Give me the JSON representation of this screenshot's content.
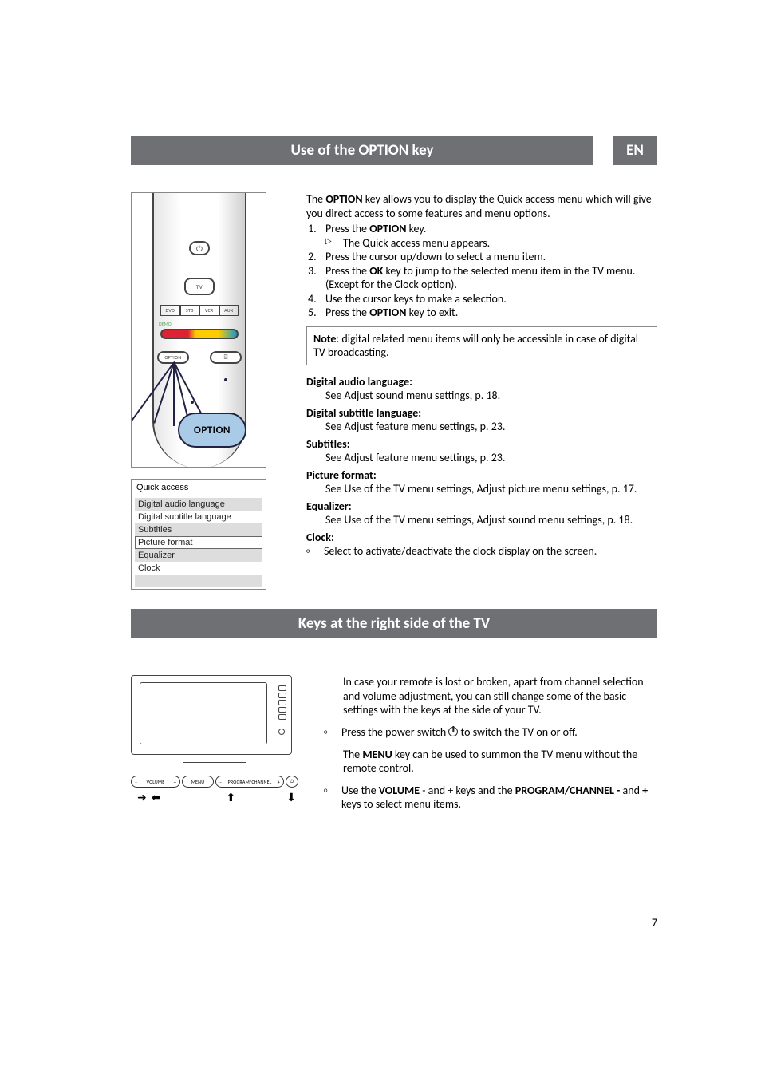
{
  "lang_pill": "EN",
  "section1": {
    "title": "Use of the OPTION key",
    "remote": {
      "power_icon": "⏻",
      "tv_label": "TV",
      "src_buttons": [
        "DVD",
        "STB",
        "VCR",
        "AUX"
      ],
      "demo_label": "DEMO",
      "option_label": "OPTION",
      "guide_icon": "⌼",
      "callout": "OPTION"
    },
    "quick_access": {
      "title": "Quick access",
      "items": [
        "Digital audio language",
        "Digital subtitle language",
        "Subtitles",
        "Picture format",
        "Equalizer",
        "Clock"
      ]
    },
    "intro": {
      "pre": "The ",
      "bold": "OPTION",
      "post": " key allows you to display the Quick access menu which will give you direct access to some features and menu options."
    },
    "steps": [
      {
        "num": "1.",
        "pre": "Press the ",
        "bold": "OPTION",
        "post": " key."
      },
      {
        "sub_mark": "▷",
        "text": "The Quick access menu appears."
      },
      {
        "num": "2.",
        "text": "Press the cursor up/down to select a menu item."
      },
      {
        "num": "3.",
        "pre": "Press the ",
        "bold": "OK",
        "post": " key to jump to the selected menu item in the TV menu. (Except for the Clock option)."
      },
      {
        "num": "4.",
        "text": "Use the cursor keys to make a selection."
      },
      {
        "num": "5.",
        "pre": "Press the ",
        "bold": "OPTION",
        "post": " key to exit."
      }
    ],
    "note": {
      "bold": "Note",
      "text": ": digital related menu items will only be accessible in case of digital TV broadcasting."
    },
    "features": [
      {
        "title": "Digital audio language:",
        "body": "See Adjust sound menu settings, p. 18."
      },
      {
        "title": "Digital subtitle language:",
        "body": "See Adjust feature menu settings, p. 23."
      },
      {
        "title": "Subtitles:",
        "body": "See Adjust feature menu settings, p. 23."
      },
      {
        "title": "Picture format:",
        "body": "See Use of the TV menu settings, Adjust picture menu settings, p. 17."
      },
      {
        "title": "Equalizer:",
        "body": "See Use of the TV menu settings, Adjust sound menu settings, p. 18."
      },
      {
        "title": "Clock:",
        "bullet": "Select to activate/deactivate the clock display on the screen."
      }
    ]
  },
  "section2": {
    "title": "Keys at the right side of the TV",
    "buttons": {
      "vol_minus": "–",
      "vol_label": "VOLUME",
      "vol_plus": "+",
      "menu": "MENU",
      "prog_minus": "–",
      "prog_label": "PROGRAM/CHANNEL",
      "prog_plus": "+",
      "power": "⏻"
    },
    "arrows": {
      "a": "➜",
      "b": "⬅",
      "c": "⬆",
      "d": "⬇"
    },
    "intro": "In case your remote is lost or broken, apart from channel selection and volume adjustment, you can still change some of the basic settings with the keys at the side of your TV.",
    "bullet1_pre": "Press the power switch ",
    "bullet1_post": " to switch the TV on or off.",
    "menu_line_pre": "The ",
    "menu_bold": "MENU",
    "menu_line_post": " key can be used to summon the TV menu without the remote control.",
    "bullet2_pre": "Use the ",
    "bullet2_b1": "VOLUME",
    "bullet2_mid1": " - and + keys and the ",
    "bullet2_b2": "PROGRAM/CHANNEL -",
    "bullet2_mid2": " and ",
    "bullet2_b3": "+",
    "bullet2_post": " keys to select menu items."
  },
  "page_number": "7",
  "bullet_mark": "○",
  "sub_mark": "▷"
}
